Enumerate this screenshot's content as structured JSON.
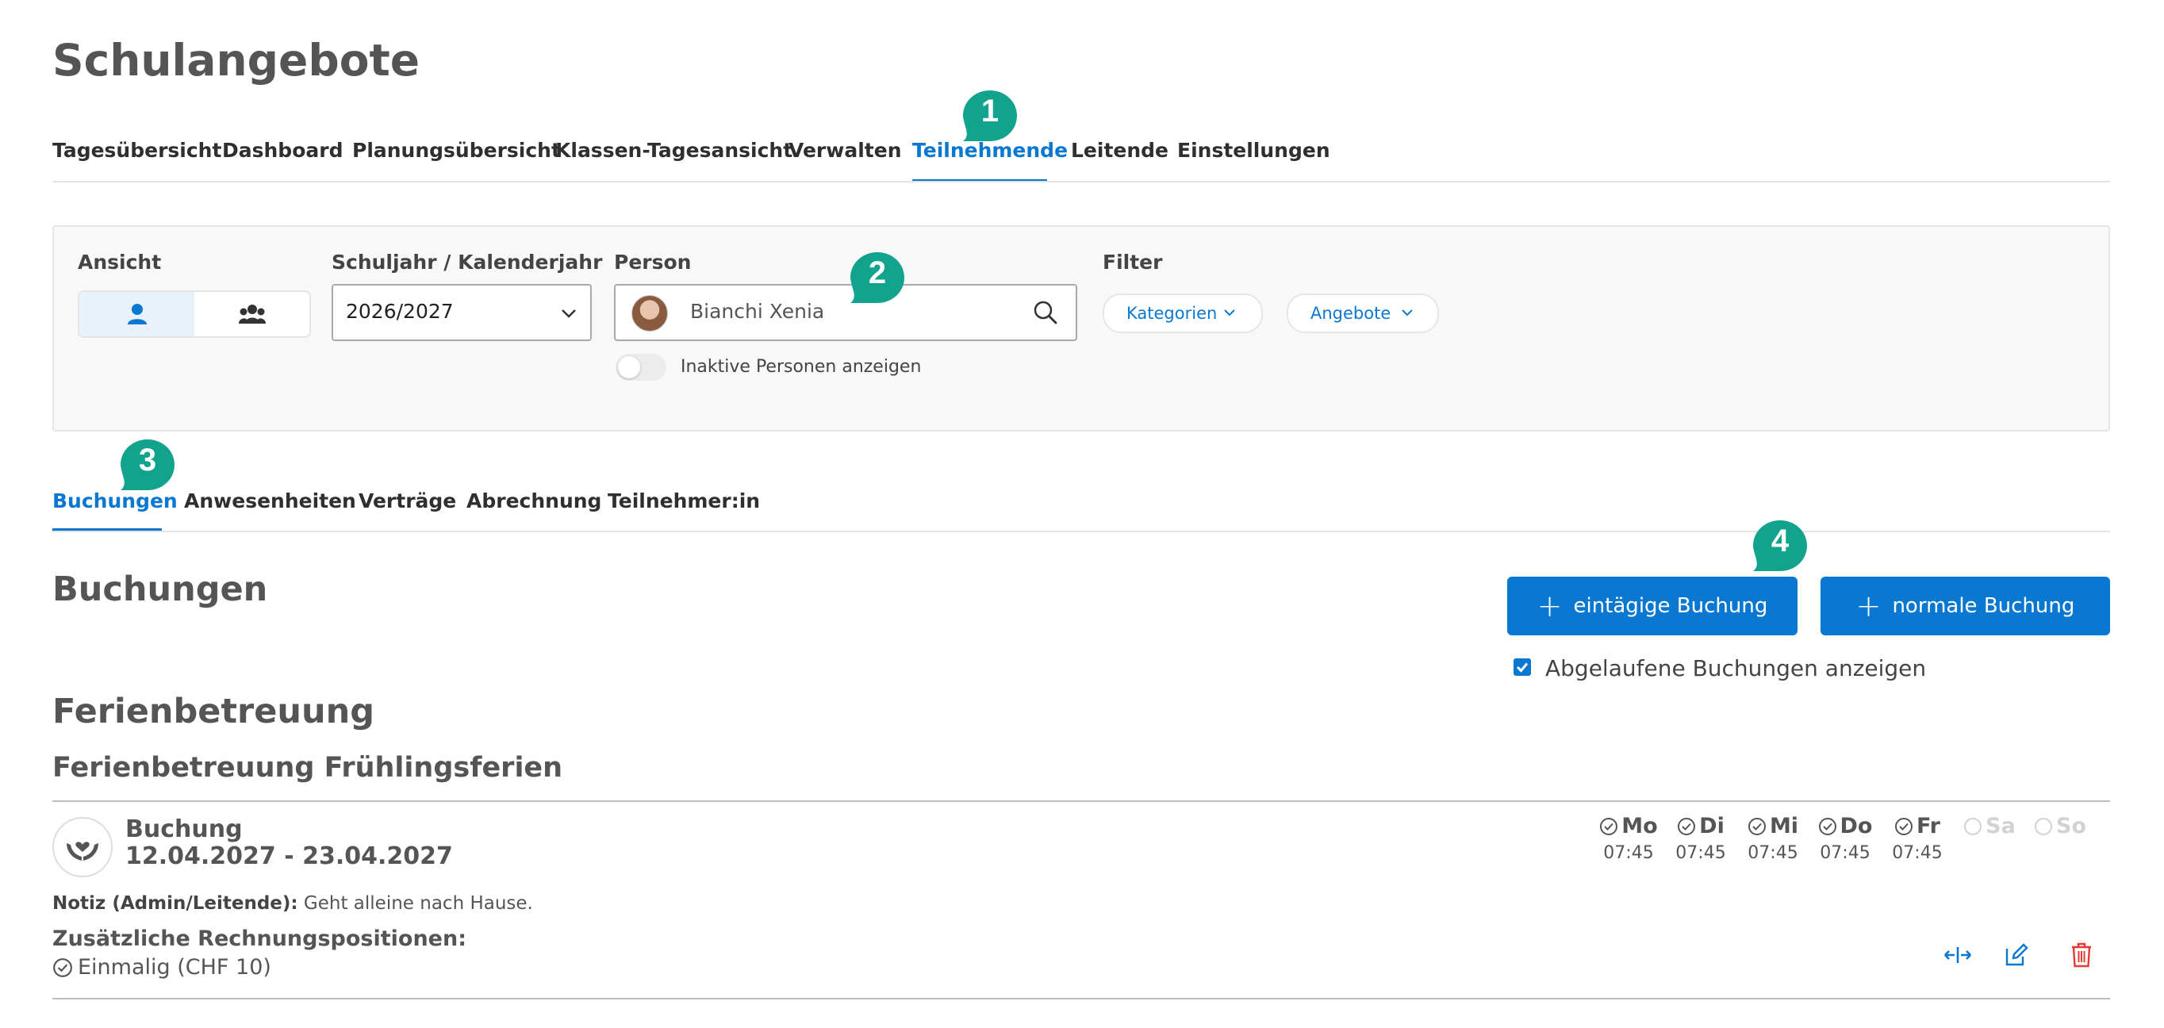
{
  "page": {
    "title": "Schulangebote"
  },
  "main_tabs": [
    {
      "label": "Tagesübersicht"
    },
    {
      "label": "Dashboard"
    },
    {
      "label": "Planungsübersicht"
    },
    {
      "label": "Klassen-Tagesansicht"
    },
    {
      "label": "Verwalten"
    },
    {
      "label": "Teilnehmende",
      "active": true
    },
    {
      "label": "Leitende"
    },
    {
      "label": "Einstellungen"
    }
  ],
  "filters": {
    "ansicht_label": "Ansicht",
    "year_label": "Schuljahr / Kalenderjahr",
    "year_value": "2026/2027",
    "person_label": "Person",
    "person_value": "Bianchi Xenia",
    "inactive_toggle_label": "Inaktive Personen anzeigen",
    "filter_label": "Filter",
    "filter_pills": [
      "Kategorien",
      "Angebote"
    ]
  },
  "sub_tabs": [
    {
      "label": "Buchungen",
      "active": true
    },
    {
      "label": "Anwesenheiten"
    },
    {
      "label": "Verträge"
    },
    {
      "label": "Abrechnung"
    },
    {
      "label": "Teilnehmer:in"
    }
  ],
  "section": {
    "title": "Buchungen",
    "button_one_day": "eintägige Buchung",
    "button_normal": "normale Buchung",
    "show_expired_label": "Abgelaufene Buchungen anzeigen",
    "show_expired_checked": true
  },
  "category": {
    "title": "Ferienbetreuung",
    "subtitle": "Ferienbetreuung Frühlingsferien"
  },
  "booking": {
    "title": "Buchung",
    "dates": "12.04.2027 - 23.04.2027",
    "days": [
      {
        "label": "Mo",
        "time": "07:45",
        "active": true
      },
      {
        "label": "Di",
        "time": "07:45",
        "active": true
      },
      {
        "label": "Mi",
        "time": "07:45",
        "active": true
      },
      {
        "label": "Do",
        "time": "07:45",
        "active": true
      },
      {
        "label": "Fr",
        "time": "07:45",
        "active": true
      },
      {
        "label": "Sa",
        "time": "",
        "active": false
      },
      {
        "label": "So",
        "time": "",
        "active": false
      }
    ],
    "note_label": "Notiz (Admin/Leitende):",
    "note_value": "Geht alleine nach Hause.",
    "extra_title": "Zusätzliche Rechnungspositionen:",
    "extra_item": "Einmalig (CHF 10)"
  },
  "badges": [
    "1",
    "2",
    "3",
    "4"
  ],
  "colors": {
    "accent": "#0a78d0",
    "badge": "#12a38e",
    "danger": "#e53935"
  }
}
